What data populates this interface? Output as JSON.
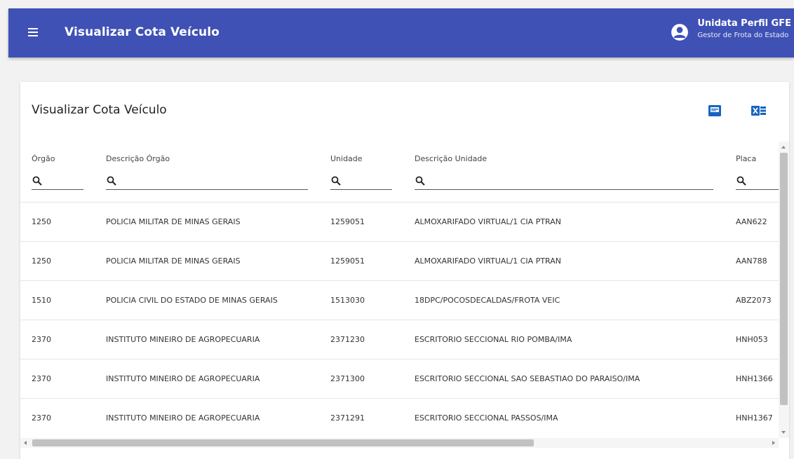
{
  "appbar": {
    "title": "Visualizar Cota Veículo",
    "user_name": "Unidata Perfil GFE",
    "user_role": "Gestor de Frota do Estado",
    "color": "#3f51b5"
  },
  "card": {
    "title": "Visualizar Cota Veículo",
    "export_icons": [
      "pdf-icon",
      "excel-icon"
    ]
  },
  "table": {
    "columns": [
      {
        "label": "Órgão",
        "filter_placeholder": ""
      },
      {
        "label": "Descrição Órgão",
        "filter_placeholder": ""
      },
      {
        "label": "Unidade",
        "filter_placeholder": ""
      },
      {
        "label": "Descrição Unidade",
        "filter_placeholder": ""
      },
      {
        "label": "Placa",
        "filter_placeholder": ""
      }
    ],
    "rows": [
      [
        "1250",
        "POLICIA MILITAR DE MINAS GERAIS",
        "1259051",
        "ALMOXARIFADO VIRTUAL/1 CIA PTRAN",
        "AAN622"
      ],
      [
        "1250",
        "POLICIA MILITAR DE MINAS GERAIS",
        "1259051",
        "ALMOXARIFADO VIRTUAL/1 CIA PTRAN",
        "AAN788"
      ],
      [
        "1510",
        "POLICIA CIVIL DO ESTADO DE MINAS GERAIS",
        "1513030",
        "18DPC/POCOSDECALDAS/FROTA VEIC",
        "ABZ2073"
      ],
      [
        "2370",
        "INSTITUTO MINEIRO DE AGROPECUARIA",
        "2371230",
        "ESCRITORIO SECCIONAL RIO POMBA/IMA",
        "HNH053"
      ],
      [
        "2370",
        "INSTITUTO MINEIRO DE AGROPECUARIA",
        "2371300",
        "ESCRITORIO SECCIONAL SAO SEBASTIAO DO PARAISO/IMA",
        "HNH1366"
      ],
      [
        "2370",
        "INSTITUTO MINEIRO DE AGROPECUARIA",
        "2371291",
        "ESCRITORIO SECCIONAL PASSOS/IMA",
        "HNH1367"
      ]
    ]
  }
}
